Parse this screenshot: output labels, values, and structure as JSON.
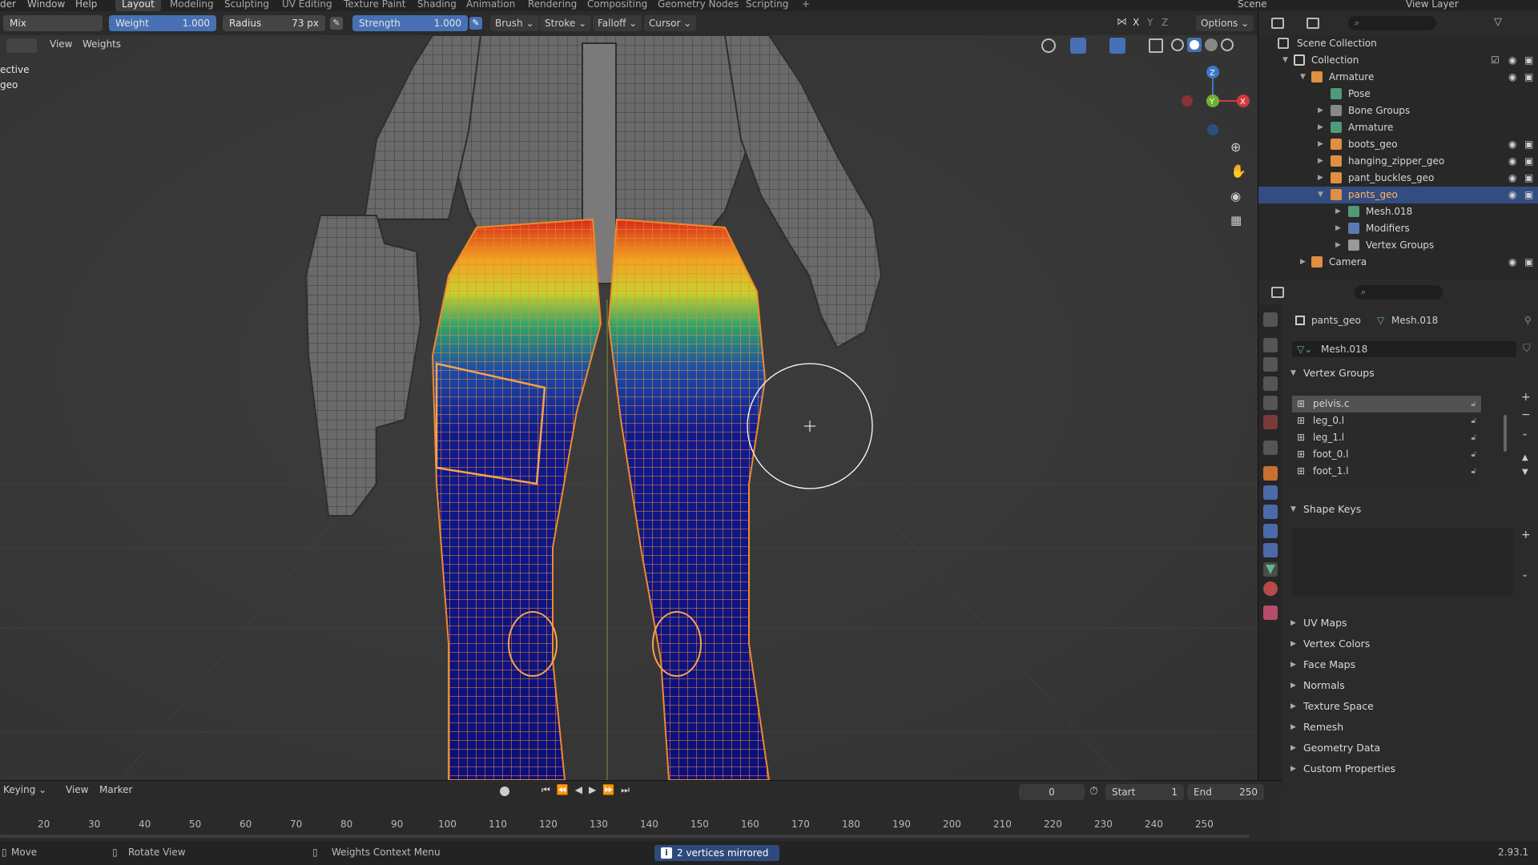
{
  "topbar": {
    "menus": [
      "der",
      "Window",
      "Help"
    ],
    "workspaces": [
      "Layout",
      "Modeling",
      "Sculpting",
      "UV Editing",
      "Texture Paint",
      "Shading",
      "Animation",
      "Rendering",
      "Compositing",
      "Geometry Nodes",
      "Scripting"
    ],
    "active_workspace": "Layout",
    "add_tab": "+",
    "scene_label": "Scene",
    "view_layer_label": "View Layer"
  },
  "tool_header": {
    "blend_mode": "Mix",
    "weight_label": "Weight",
    "weight_value": "1.000",
    "radius_label": "Radius",
    "radius_value": "73 px",
    "strength_label": "Strength",
    "strength_value": "1.000",
    "brush_menu": "Brush",
    "stroke_menu": "Stroke",
    "falloff_menu": "Falloff",
    "cursor_menu": "Cursor",
    "xyz": [
      "X",
      "Y",
      "Z"
    ],
    "options_menu": "Options"
  },
  "viewport": {
    "menus": [
      "View",
      "Weights"
    ],
    "overlay_line1": "ective",
    "overlay_line2": "geo",
    "gizmo_axes": [
      "Z",
      "Y",
      "X"
    ]
  },
  "outliner": {
    "rows": [
      {
        "label": "Scene Collection"
      },
      {
        "label": "Collection"
      },
      {
        "label": "Armature"
      },
      {
        "label": "Pose"
      },
      {
        "label": "Bone Groups"
      },
      {
        "label": "Armature"
      },
      {
        "label": "boots_geo"
      },
      {
        "label": "hanging_zipper_geo"
      },
      {
        "label": "pant_buckles_geo"
      },
      {
        "label": "pants_geo"
      },
      {
        "label": "Mesh.018"
      },
      {
        "label": "Modifiers"
      },
      {
        "label": "Vertex Groups"
      },
      {
        "label": "Camera"
      }
    ]
  },
  "properties": {
    "object_name": "pants_geo",
    "mesh_name": "Mesh.018",
    "data_block": "Mesh.018",
    "vertex_groups_title": "Vertex Groups",
    "vertex_groups": [
      "pelvis.c",
      "leg_0.l",
      "leg_1.l",
      "foot_0.l",
      "foot_1.l"
    ],
    "shape_keys_title": "Shape Keys",
    "sections": [
      "UV Maps",
      "Vertex Colors",
      "Face Maps",
      "Normals",
      "Texture Space",
      "Remesh",
      "Geometry Data",
      "Custom Properties"
    ]
  },
  "timeline": {
    "keying_menu": "Keying",
    "view_menu": "View",
    "marker_menu": "Marker",
    "current_frame": "0",
    "start_label": "Start",
    "start_value": "1",
    "end_label": "End",
    "end_value": "250",
    "ruler": [
      "20",
      "30",
      "40",
      "50",
      "60",
      "70",
      "80",
      "90",
      "100",
      "110",
      "120",
      "130",
      "140",
      "150",
      "160",
      "170",
      "180",
      "190",
      "200",
      "210",
      "220",
      "230",
      "240",
      "250"
    ]
  },
  "statusbar": {
    "move": "Move",
    "rotate_view": "Rotate View",
    "context_menu": "Weights Context Menu",
    "notification": "2 vertices mirrored",
    "version": "2.93.1"
  },
  "colors": {
    "accent_blue": "#4771b4",
    "selection": "#334d80",
    "wire_orange": "#f08a2a"
  }
}
